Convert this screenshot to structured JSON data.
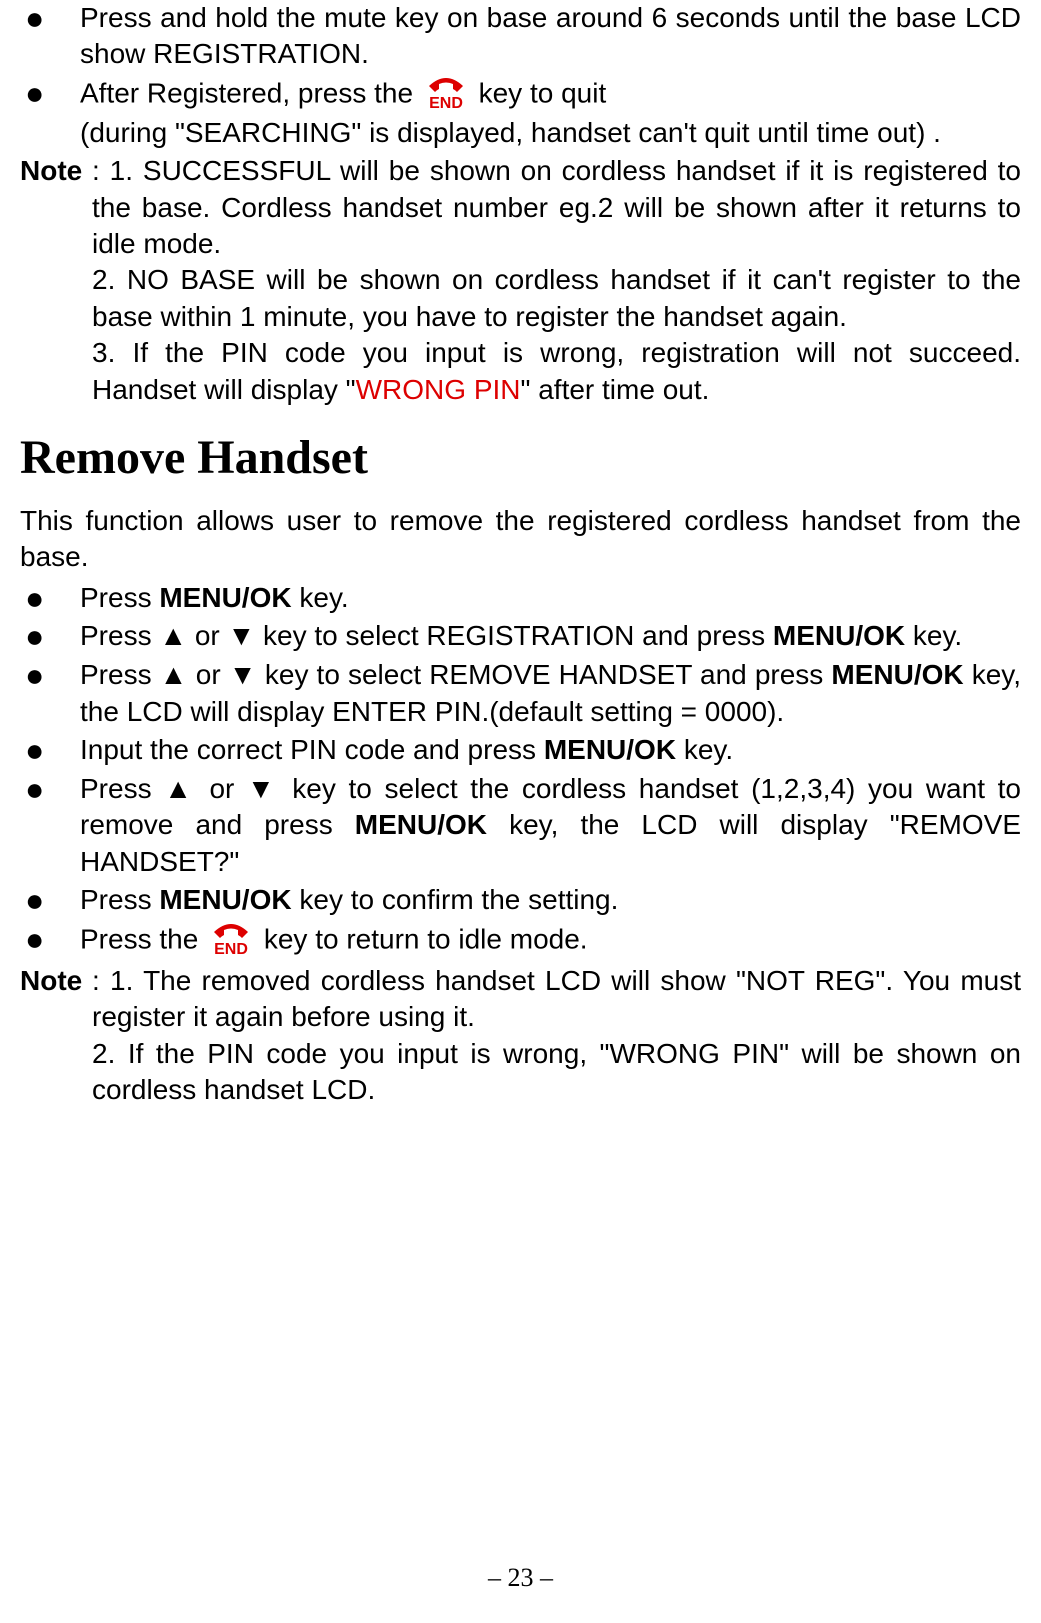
{
  "top_bullets": [
    {
      "segments": [
        {
          "type": "text",
          "value": "Press and hold the mute key on base around 6 seconds until the base LCD show REGISTRATION."
        }
      ]
    },
    {
      "segments": [
        {
          "type": "text",
          "value": "After Registered, press the "
        },
        {
          "type": "end-icon"
        },
        {
          "type": "text",
          "value": " key to quit"
        },
        {
          "type": "br"
        },
        {
          "type": "text",
          "value": "(during \"SEARCHING\" is displayed, handset can't quit until time out)   ."
        }
      ]
    }
  ],
  "note1": {
    "label": "Note",
    "items": [
      {
        "segments": [
          {
            "type": "text",
            "value": ": 1. SUCCESSFUL will be shown on cordless handset if it is registered to the base. Cordless handset number eg.2 will be shown after it returns to idle mode."
          }
        ]
      },
      {
        "segments": [
          {
            "type": "text",
            "value": "2. NO BASE will be shown on cordless handset if it can't register to the base within 1 minute, you have to register the handset again."
          }
        ]
      },
      {
        "segments": [
          {
            "type": "text",
            "value": "3. If the PIN code you input is wrong, registration will not succeed. Handset will display \""
          },
          {
            "type": "red",
            "value": "WRONG PIN"
          },
          {
            "type": "text",
            "value": "\" after time out."
          }
        ]
      }
    ]
  },
  "heading": "Remove Handset",
  "intro": "This function allows user to remove the registered cordless handset from the base.",
  "bullets2": [
    {
      "segments": [
        {
          "type": "text",
          "value": "Press "
        },
        {
          "type": "bold",
          "value": "MENU/OK"
        },
        {
          "type": "text",
          "value": " key."
        }
      ]
    },
    {
      "segments": [
        {
          "type": "text",
          "value": "Press ▲ or ▼ key to select REGISTRATION and press "
        },
        {
          "type": "bold",
          "value": "MENU/OK"
        },
        {
          "type": "text",
          "value": " key."
        }
      ]
    },
    {
      "segments": [
        {
          "type": "text",
          "value": "Press ▲ or ▼ key to select REMOVE HANDSET and press "
        },
        {
          "type": "bold",
          "value": "MENU/OK"
        },
        {
          "type": "text",
          "value": " key, the LCD will display ENTER PIN.(default setting = 0000)."
        }
      ]
    },
    {
      "segments": [
        {
          "type": "text",
          "value": "Input the correct PIN code and press "
        },
        {
          "type": "bold",
          "value": "MENU/OK"
        },
        {
          "type": "text",
          "value": " key."
        }
      ]
    },
    {
      "segments": [
        {
          "type": "text",
          "value": "Press ▲ or ▼ key to select the cordless handset (1,2,3,4) you want to remove and press "
        },
        {
          "type": "bold",
          "value": "MENU/OK"
        },
        {
          "type": "text",
          "value": " key, the LCD will display \"REMOVE HANDSET?\""
        }
      ]
    },
    {
      "segments": [
        {
          "type": "text",
          "value": "Press "
        },
        {
          "type": "bold",
          "value": "MENU/OK"
        },
        {
          "type": "text",
          "value": " key to confirm the setting."
        }
      ]
    },
    {
      "segments": [
        {
          "type": "text",
          "value": "Press the "
        },
        {
          "type": "end-icon"
        },
        {
          "type": "text",
          "value": " key to return to idle mode."
        }
      ]
    }
  ],
  "note2": {
    "label": "Note",
    "items": [
      {
        "segments": [
          {
            "type": "text",
            "value": ": 1. The removed cordless handset LCD will show \"NOT REG\". You must register it again before using it."
          }
        ]
      },
      {
        "segments": [
          {
            "type": "text",
            "value": "2. If the PIN code you input is wrong, \"WRONG PIN\" will be shown on cordless handset LCD."
          }
        ]
      }
    ]
  },
  "page_number": "– 23 –",
  "end_icon_label": "END"
}
